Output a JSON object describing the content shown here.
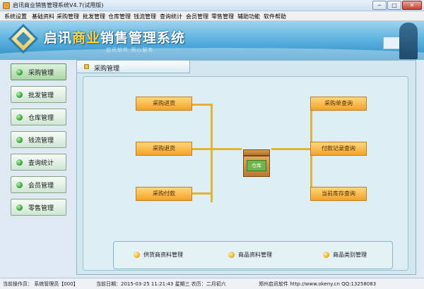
{
  "window": {
    "title": "启讯商业销售管理系统V4.7(试用版)",
    "minimize": "─",
    "maximize": "□",
    "close": "✕"
  },
  "menu": [
    "系统设置",
    "基础资料",
    "采购管理",
    "批发管理",
    "仓库管理",
    "钱流管理",
    "查询统计",
    "会员管理",
    "零售管理",
    "辅助功能",
    "软件帮助"
  ],
  "banner": {
    "brand_pre": "启讯",
    "brand_highlight": "商业",
    "brand_post": "销售管理系统",
    "subtitle": "启讯软件 用心服务"
  },
  "sidebar": {
    "items": [
      {
        "label": "采购管理"
      },
      {
        "label": "批发管理"
      },
      {
        "label": "仓库管理"
      },
      {
        "label": "钱流管理"
      },
      {
        "label": "查询统计"
      },
      {
        "label": "会员管理"
      },
      {
        "label": "零售管理"
      }
    ]
  },
  "panel": {
    "tab_label": "采购管理",
    "left_buttons": [
      "采购进货",
      "采购退货",
      "采购付款"
    ],
    "right_buttons": [
      "采购单查询",
      "付款记录查询",
      "当前库存查询"
    ],
    "center_icon_label": "仓库",
    "sub_items": [
      "供货商资料管理",
      "商品资料管理",
      "商品类别管理"
    ]
  },
  "statusbar": {
    "operator": "当前操作员：  系统管理员【000】",
    "date": "当前日期：2015-03-25 11:21:43 星期三 农历：二月初六",
    "company": "郑州启讯软件 http://www.okeny.cn  QQ:13258083"
  },
  "colors": {
    "accent_orange": "#f4a22a",
    "connector": "#e2b430",
    "nav_green": "#3aa83a",
    "banner_blue": "#2c8dc6"
  }
}
